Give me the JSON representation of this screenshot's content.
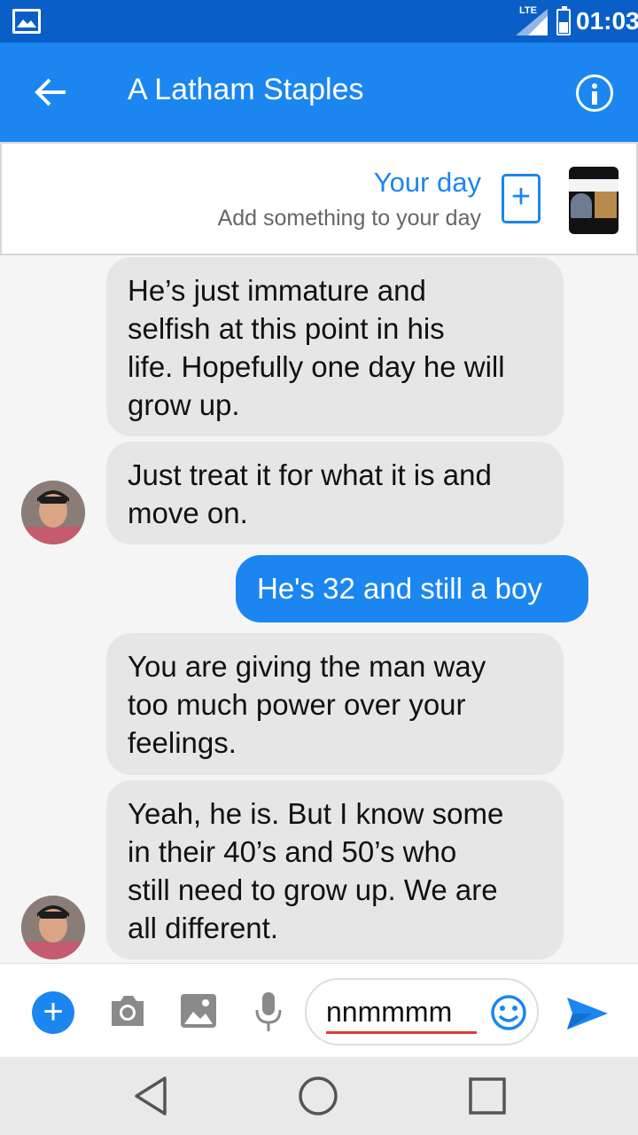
{
  "status_bar": {
    "network_label": "LTE",
    "time": "01:03"
  },
  "app_bar": {
    "title": "A Latham Staples",
    "back_icon": "back-arrow-icon",
    "info_icon": "info-icon"
  },
  "your_day": {
    "title": "Your day",
    "subtitle": "Add something to your day",
    "add_icon": "plus-icon"
  },
  "messages": [
    {
      "direction": "incoming",
      "text_lines": [
        "He’s just immature and",
        "selfish at this point in his",
        "life. Hopefully one day he will",
        "grow up."
      ]
    },
    {
      "direction": "incoming",
      "text_lines": [
        "Just treat it for what it is and",
        "move on."
      ]
    },
    {
      "direction": "outgoing",
      "text_lines": [
        "He's 32 and still a boy"
      ]
    },
    {
      "direction": "incoming",
      "text_lines": [
        "You are giving the man way",
        "too much power over your",
        "feelings."
      ]
    },
    {
      "direction": "incoming",
      "text_lines": [
        "Yeah, he is. But I know some",
        "in their 40’s and 50’s who",
        "still need to grow up. We are",
        "all different."
      ]
    }
  ],
  "composer": {
    "input_value": "nnmmmm",
    "icons": [
      "plus-icon",
      "camera-icon",
      "image-icon",
      "microphone-icon",
      "emoji-icon",
      "send-icon"
    ]
  },
  "nav_bar": {
    "icons": [
      "back-triangle-icon",
      "home-circle-icon",
      "recents-square-icon"
    ]
  },
  "colors": {
    "status_bar": "#0a5fc6",
    "app_bar": "#1b86f0",
    "incoming_bubble": "#e6e6e6",
    "outgoing_bubble": "#1b86f0"
  }
}
